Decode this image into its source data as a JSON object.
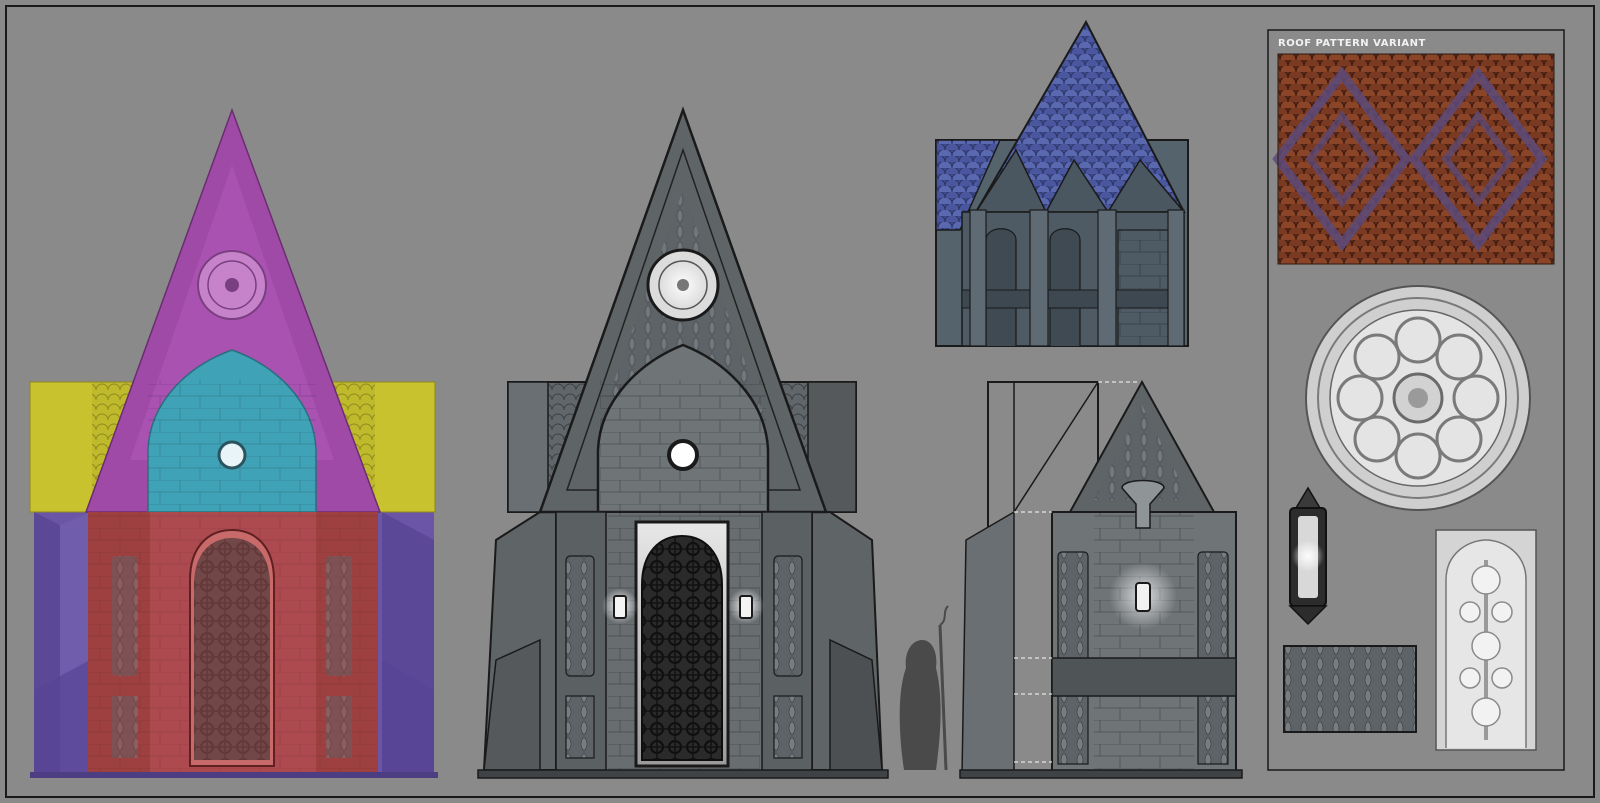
{
  "sheet": {
    "panel_label": "Roof Pattern Variant"
  },
  "palette": {
    "background": "#8a8a8a",
    "frame": "#1a1a1a",
    "overlay_purple_gable": "#a04aa8",
    "overlay_teal_arch": "#3fa2b6",
    "overlay_yellow_sides": "#c8c22e",
    "overlay_red_portal": "#b04a4a",
    "overlay_violet_base": "#6a55a6",
    "stone_dark": "#5a5f63",
    "stone_mid": "#72777b",
    "roof_blue": "#3f4c8c",
    "roof_tile_orange": "#7b3a24",
    "roof_tile_violet": "#5a4a7a"
  },
  "icons": [
    "rose-window-icon",
    "gothic-lantern-icon",
    "wrought-iron-gate-icon",
    "hooded-figure-silhouette",
    "wall-sconce-icon"
  ]
}
